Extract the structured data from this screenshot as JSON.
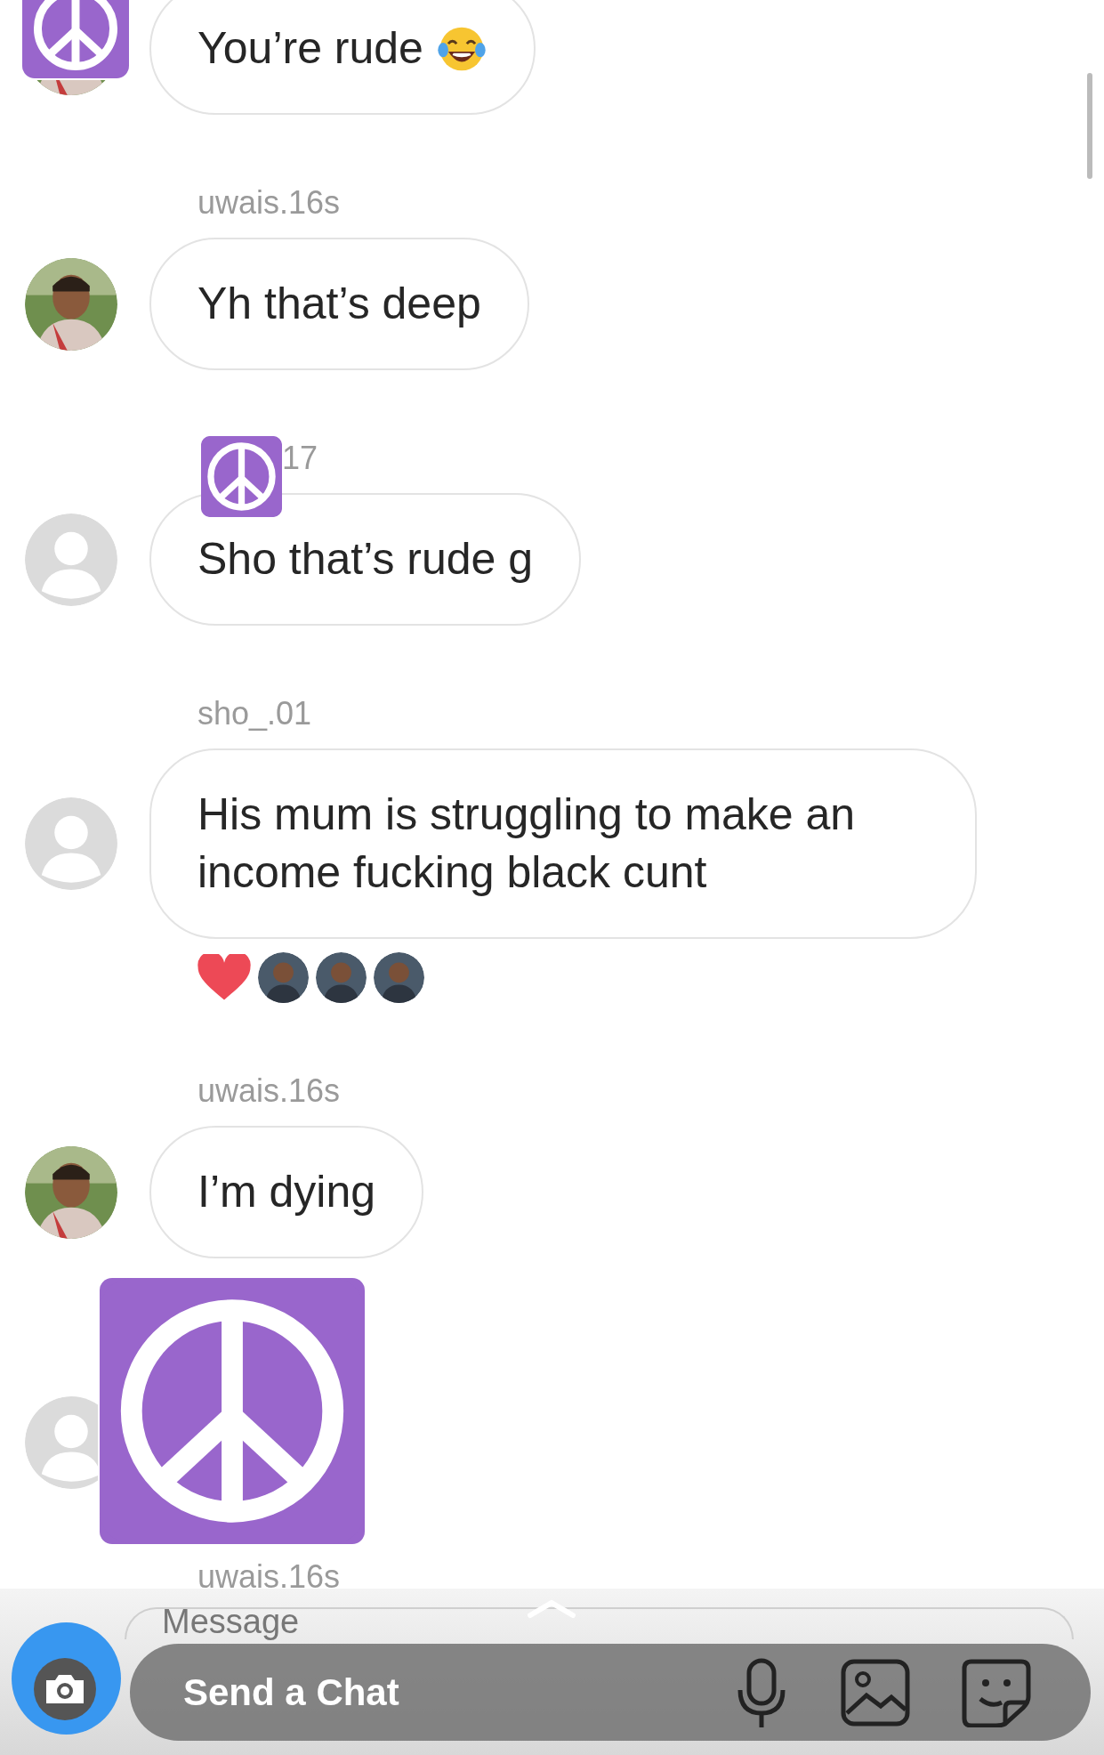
{
  "conversation": [
    {
      "kind": "message",
      "avatar": {
        "kind": "photo"
      },
      "text": "You’re rude",
      "emoji": {
        "kind": "tears-of-joy"
      }
    },
    {
      "kind": "message",
      "username": "uwais.16s",
      "avatar": {
        "kind": "photo"
      },
      "text": "Yh that’s deep"
    },
    {
      "kind": "message",
      "username": "17",
      "sticker": {
        "kind": "peace"
      },
      "avatar": {
        "kind": "default"
      },
      "text": "Sho that’s rude g"
    },
    {
      "kind": "message",
      "username": "sho_.01",
      "avatar": {
        "kind": "default"
      },
      "text": "His mum is struggling to make an income fucking black cunt",
      "reactions": [
        {
          "kind": "heart"
        },
        {
          "kind": "avatar"
        },
        {
          "kind": "avatar"
        },
        {
          "kind": "avatar"
        }
      ]
    },
    {
      "kind": "message",
      "username": "uwais.16s",
      "avatar": {
        "kind": "photo"
      },
      "text": "I’m dying"
    },
    {
      "kind": "covered",
      "avatar": {
        "kind": "default"
      }
    },
    {
      "kind": "username",
      "username": "uwais.16s"
    }
  ],
  "stickers": [
    {
      "kind": "peace"
    },
    {
      "kind": "peace"
    }
  ],
  "composer": {
    "placeholder": "Message"
  },
  "snap_bar": {
    "label": "Send a Chat"
  }
}
